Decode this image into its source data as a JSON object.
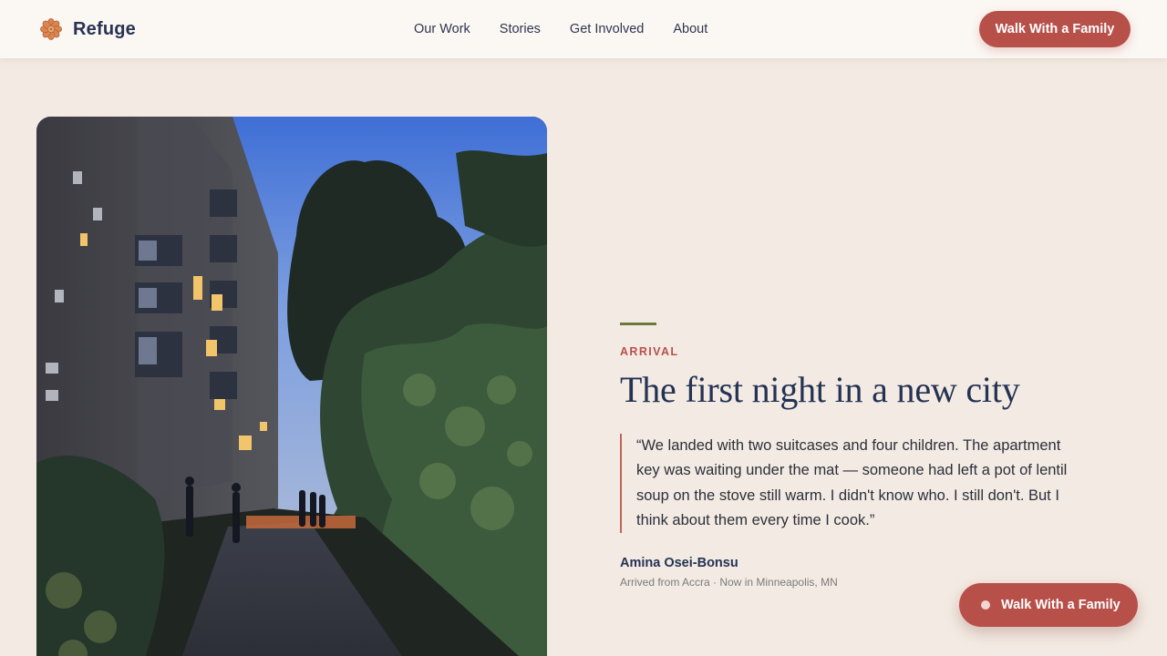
{
  "brand": {
    "name": "Refuge",
    "icon": "flower-logo-icon"
  },
  "nav": {
    "items": [
      "Our Work",
      "Stories",
      "Get Involved",
      "About"
    ]
  },
  "header_cta": {
    "label": "Walk With a Family"
  },
  "story": {
    "eyebrow": "ARRIVAL",
    "title": "The first night in a new city",
    "quote": "“We landed with two suitcases and four children. The apartment key was waiting under the mat — someone had left a pot of lentil soup on the stove still warm. I didn't know who. I still don't. But I think about them every time I cook.”",
    "author_name": "Amina Osei-Bonsu",
    "author_meta": "Arrived from Accra · Now in Minneapolis, MN"
  },
  "photo": {
    "subject": "evening-apartment-courtyard-photo"
  },
  "float_cta": {
    "label": "Walk With a Family"
  },
  "colors": {
    "background": "#f3ebe3",
    "header": "#fbf7f3",
    "accent": "#b8504a",
    "olive": "#6b7a3c",
    "navy": "#243253"
  }
}
